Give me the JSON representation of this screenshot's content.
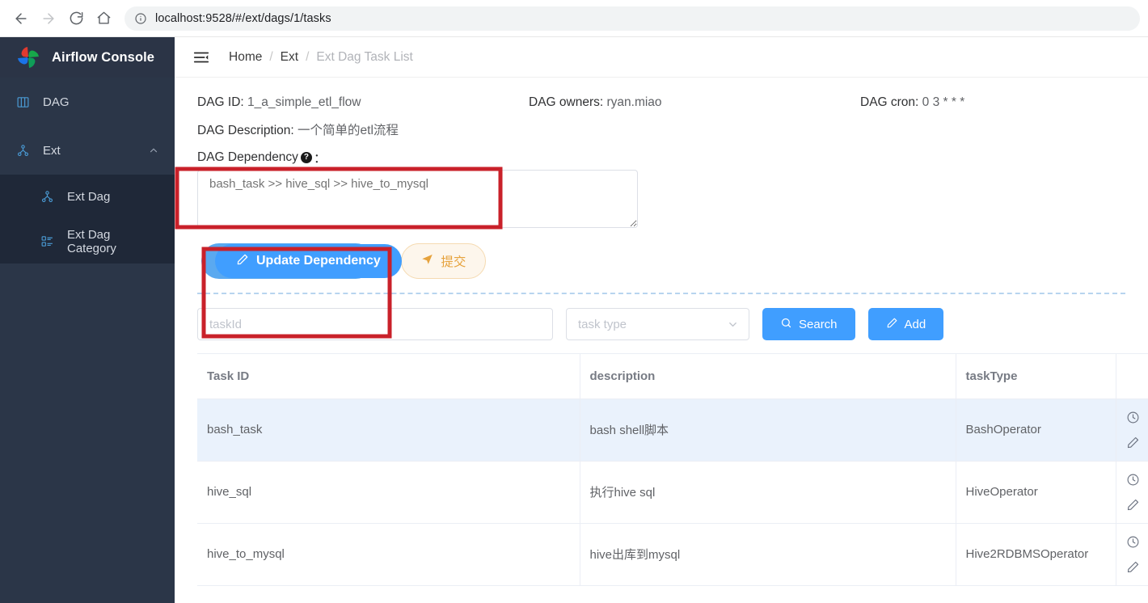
{
  "browser": {
    "back_icon": "arrow-left-icon",
    "forward_icon": "arrow-right-icon",
    "reload_icon": "reload-icon",
    "home_icon": "home-icon",
    "info_icon": "info-circle-icon",
    "url": "localhost:9528/#/ext/dags/1/tasks"
  },
  "sidebar": {
    "brand": "Airflow Console",
    "logo_icon": "airflow-pinwheel-logo",
    "items": [
      {
        "label": "DAG",
        "icon": "dag-columns-icon"
      },
      {
        "label": "Ext",
        "icon": "ext-node-tree-icon",
        "expanded": true,
        "arrow_icon": "chevron-up-icon"
      }
    ],
    "sub_items": [
      {
        "label": "Ext Dag",
        "icon": "ext-dag-node-icon",
        "active": true
      },
      {
        "label": "Ext Dag Category",
        "icon": "category-list-icon",
        "active": false
      }
    ]
  },
  "topbar": {
    "hamburger_icon": "collapse-menu-icon",
    "breadcrumb": [
      {
        "label": "Home",
        "current": false
      },
      {
        "label": "Ext",
        "current": false
      },
      {
        "label": "Ext Dag Task List",
        "current": true
      }
    ],
    "separator": "/"
  },
  "dag_info": {
    "id_label": "DAG ID:",
    "id_value": "1_a_simple_etl_flow",
    "owners_label": "DAG owners:",
    "owners_value": "ryan.miao",
    "cron_label": "DAG cron:",
    "cron_value": "0 3 * * *",
    "description_label": "DAG Description:",
    "description_value": "一个简单的etl流程"
  },
  "dependency": {
    "label": "DAG Dependency",
    "help_icon": "question-mark-icon",
    "help_badge": "?",
    "colon": "：",
    "value": "bash_task >> hive_sql >> hive_to_mysql",
    "placeholder": "bash_task >> hive_sql >> hive_to_mysql"
  },
  "actions": {
    "primary_label": "Update Dependency",
    "primary_icon": "edit-pencil-icon",
    "overlay_label": "Update Dependency",
    "overlay_icon": "edit-pencil-icon",
    "submit_label": "提交",
    "submit_icon": "send-plane-icon"
  },
  "search": {
    "task_id_placeholder": "taskId",
    "task_id_value": "",
    "task_type_placeholder": "task type",
    "task_type_value": "",
    "task_type_caret_icon": "chevron-down-icon",
    "search_label": "Search",
    "search_icon": "search-icon",
    "add_label": "Add",
    "add_icon": "edit-pencil-icon"
  },
  "table": {
    "columns": [
      {
        "key": "task_id",
        "label": "Task ID"
      },
      {
        "key": "description",
        "label": "description"
      },
      {
        "key": "task_type",
        "label": "taskType"
      },
      {
        "key": "ops",
        "label": ""
      }
    ],
    "rows": [
      {
        "task_id": "bash_task",
        "description": "bash shell脚本",
        "task_type": "BashOperator",
        "highlighted": true,
        "ops": [
          {
            "icon": "clock-icon",
            "name": "schedule-icon"
          },
          {
            "icon": "edit-pencil-icon",
            "name": "edit-icon"
          }
        ]
      },
      {
        "task_id": "hive_sql",
        "description": "执行hive sql",
        "task_type": "HiveOperator",
        "highlighted": false,
        "ops": [
          {
            "icon": "clock-icon",
            "name": "schedule-icon"
          },
          {
            "icon": "edit-pencil-icon",
            "name": "edit-icon"
          }
        ]
      },
      {
        "task_id": "hive_to_mysql",
        "description": "hive出库到mysql",
        "task_type": "Hive2RDBMSOperator",
        "highlighted": false,
        "ops": [
          {
            "icon": "clock-icon",
            "name": "schedule-icon"
          },
          {
            "icon": "edit-pencil-icon",
            "name": "edit-icon"
          }
        ]
      }
    ]
  },
  "colors": {
    "sidebar_bg": "#2b3648",
    "sidebar_sub_bg": "#1f2838",
    "accent_blue": "#409eff",
    "light_blue": "#5aa9f0",
    "warn_bg": "#fdf6ec",
    "warn_text": "#e6a23c",
    "row_highlight": "#eaf2fc",
    "annotation_red": "#c9212a"
  }
}
